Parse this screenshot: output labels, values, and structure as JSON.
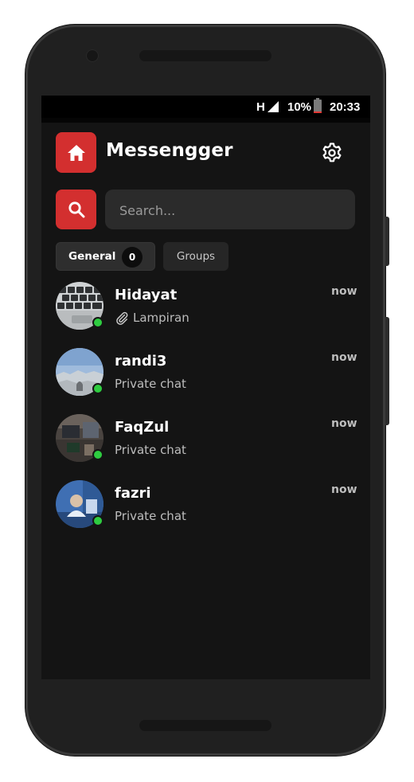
{
  "statusbar": {
    "network": "H",
    "battery_percent": "10%",
    "battery_level": 0.1,
    "time": "20:33"
  },
  "header": {
    "title": "Messengger",
    "home_icon": "home-icon",
    "settings_icon": "gear-icon"
  },
  "search": {
    "placeholder": "Search...",
    "value": "",
    "icon": "search-icon"
  },
  "tabs": [
    {
      "label": "General",
      "badge": "0",
      "active": true
    },
    {
      "label": "Groups",
      "active": false
    }
  ],
  "chats": [
    {
      "name": "Hidayat",
      "preview": "Lampiran",
      "preview_icon": "paperclip-icon",
      "time": "now",
      "online": true
    },
    {
      "name": "randi3",
      "preview": "Private chat",
      "time": "now",
      "online": true
    },
    {
      "name": "FaqZul",
      "preview": "Private chat",
      "time": "now",
      "online": true
    },
    {
      "name": "fazri",
      "preview": "Private chat",
      "time": "now",
      "online": true
    }
  ],
  "colors": {
    "accent": "#d32f2f",
    "background": "#141414",
    "online": "#2ecc40"
  }
}
